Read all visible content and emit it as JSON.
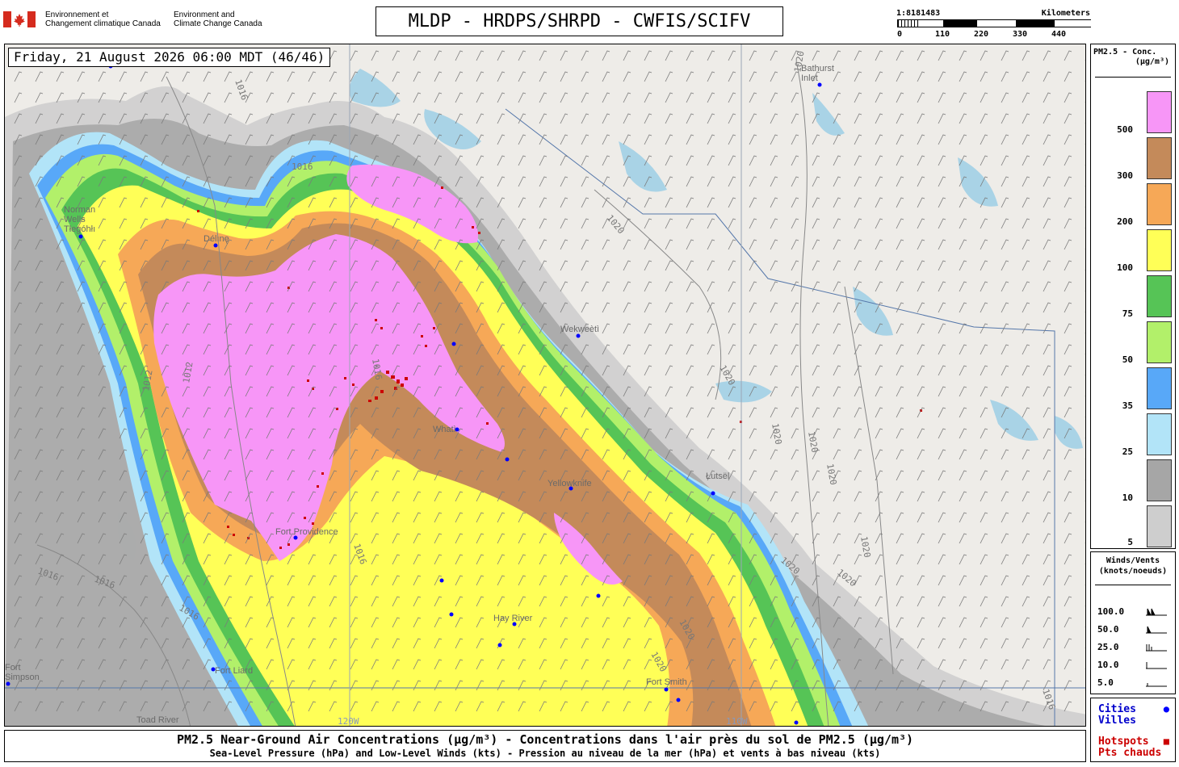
{
  "header": {
    "department_fr": "Environnement et\nChangement climatique Canada",
    "department_en": "Environment and\nClimate Change Canada",
    "title": "MLDP - HRDPS/SHRPD - CWFIS/SCIFV",
    "scale": {
      "ratio": "1:8181483",
      "unit": "Kilometers",
      "ticks": [
        "0",
        "110",
        "220",
        "330",
        "440"
      ]
    }
  },
  "map": {
    "timestamp": "Friday, 21 August 2026 06:00 MDT (46/46)",
    "cities": [
      {
        "name": "Bathurst\nInlet"
      },
      {
        "name": "Norman\nWells\nTłegóhłı"
      },
      {
        "name": "Délınę"
      },
      {
        "name": "Wekweètì"
      },
      {
        "name": "Whatì"
      },
      {
        "name": "Yellowknife"
      },
      {
        "name": "Łutsël"
      },
      {
        "name": "Fort Providence"
      },
      {
        "name": "Hay River"
      },
      {
        "name": "Fort Liard"
      },
      {
        "name": "Fort Smith"
      },
      {
        "name": "Toad River"
      },
      {
        "name": "Fort\nSimpson"
      }
    ],
    "isobar_labels": [
      "1016",
      "1016",
      "1012",
      "1012",
      "1016",
      "1016",
      "1016",
      "1016",
      "1016",
      "1020",
      "1020",
      "1020",
      "1020",
      "1020",
      "1020",
      "1020",
      "1020",
      "1020",
      "1020",
      "1020",
      "1016"
    ],
    "grid_labels": [
      "120W",
      "110W"
    ]
  },
  "legend": {
    "concentration": {
      "title_line1": "PM2.5 - Conc.",
      "title_line2": "(µg/m³)",
      "levels": [
        {
          "label": "500",
          "color": "#f796f7"
        },
        {
          "label": "300",
          "color": "#c48a5a"
        },
        {
          "label": "200",
          "color": "#f6a857"
        },
        {
          "label": "100",
          "color": "#ffff57"
        },
        {
          "label": "75",
          "color": "#56c456"
        },
        {
          "label": "50",
          "color": "#b2f06a"
        },
        {
          "label": "35",
          "color": "#58a8f8"
        },
        {
          "label": "25",
          "color": "#b2e4f8"
        },
        {
          "label": "10",
          "color": "#a6a6a6"
        },
        {
          "label": "5",
          "color": "#cecece"
        }
      ]
    },
    "winds": {
      "title_line1": "Winds/Vents",
      "title_line2": "(knots/noeuds)",
      "rows": [
        "100.0",
        "50.0",
        "25.0",
        "10.0",
        "5.0"
      ]
    },
    "points": {
      "cities_en": "Cities",
      "cities_fr": "Villes",
      "hotspots_en": "Hotspots",
      "hotspots_fr": "Pts chauds",
      "city_color": "#0000ff",
      "hotspot_color": "#cc0000"
    }
  },
  "caption": {
    "line1": "PM2.5 Near-Ground Air Concentrations (µg/m³) - Concentrations dans l'air près du sol de PM2.5 (µg/m³)",
    "line2": "Sea-Level Pressure (hPa) and Low-Level Winds (kts) - Pression au niveau de la mer (hPa) et vents à bas niveau (kts)"
  }
}
